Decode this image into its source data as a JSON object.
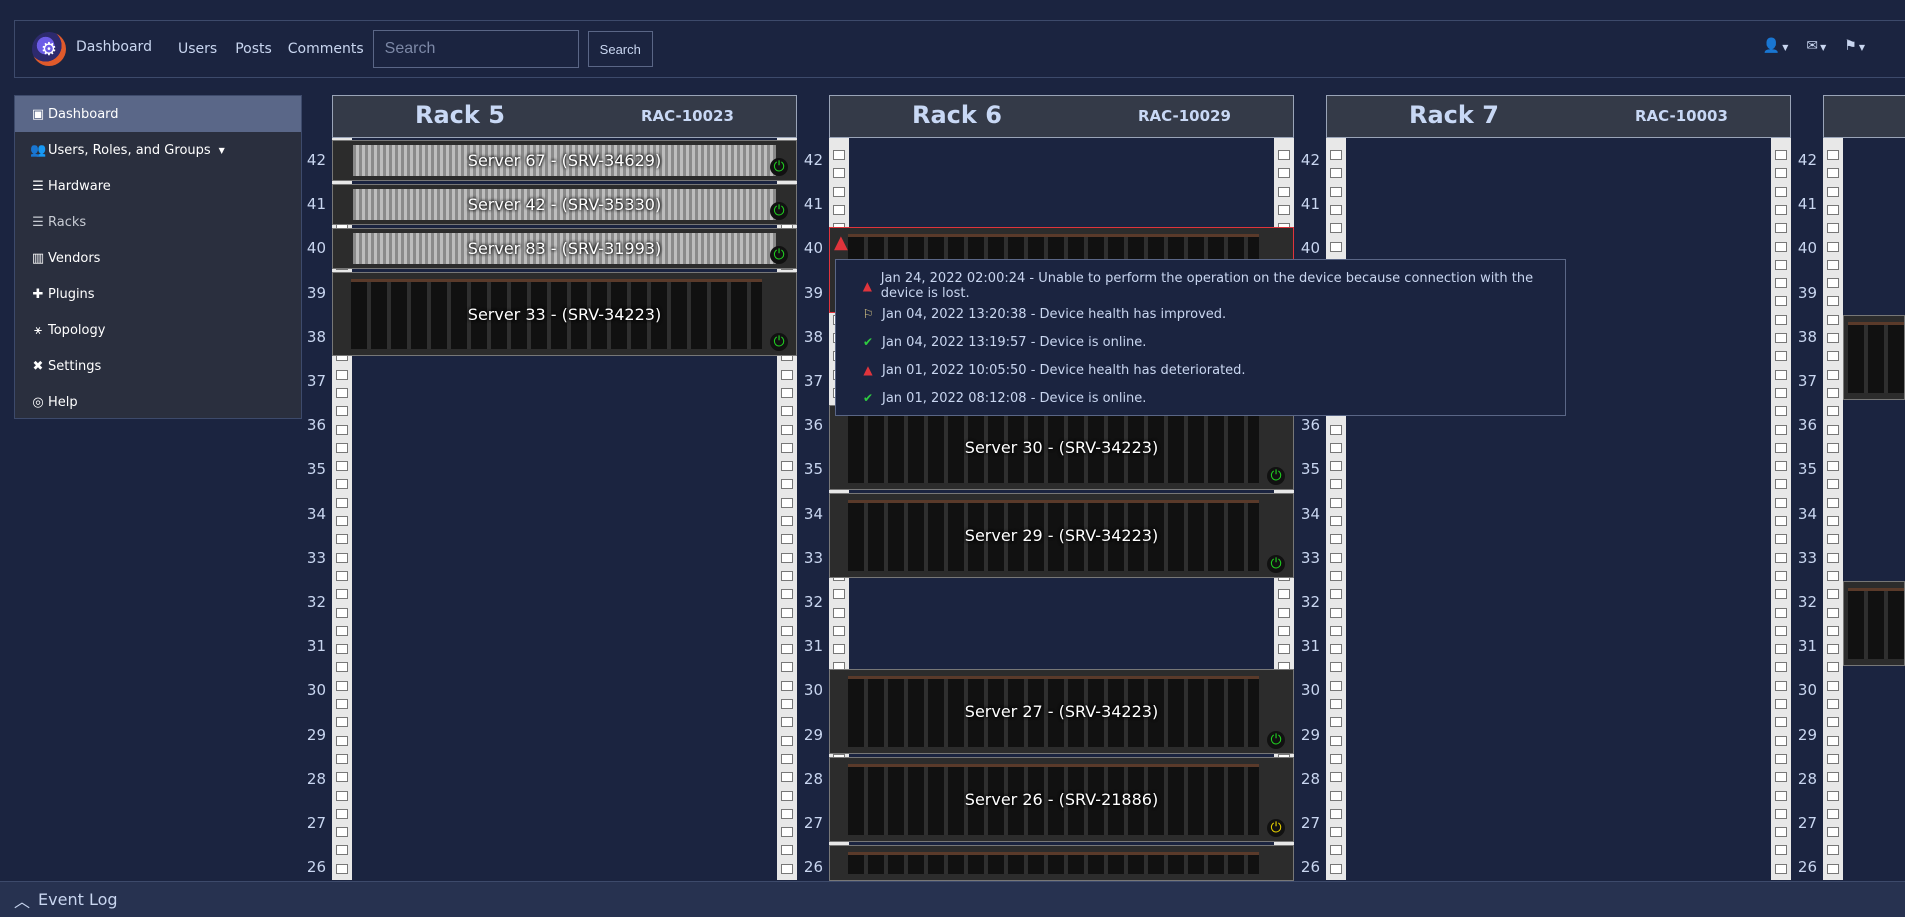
{
  "navbar": {
    "brand": "Dashboard",
    "links": [
      "Users",
      "Posts",
      "Comments"
    ],
    "search_placeholder": "Search",
    "search_button": "Search"
  },
  "sidebar": {
    "items": [
      {
        "label": "Dashboard",
        "icon": "dashboard-icon"
      },
      {
        "label": "Users, Roles, and Groups",
        "icon": "users-icon"
      },
      {
        "label": "Hardware",
        "icon": "hardware-icon"
      },
      {
        "label": "Racks",
        "icon": "racks-icon"
      },
      {
        "label": "Vendors",
        "icon": "vendors-icon"
      },
      {
        "label": "Plugins",
        "icon": "plugins-icon"
      },
      {
        "label": "Topology",
        "icon": "topology-icon"
      },
      {
        "label": "Settings",
        "icon": "settings-icon"
      },
      {
        "label": "Help",
        "icon": "help-icon"
      }
    ]
  },
  "unit_numbers": [
    "42",
    "41",
    "40",
    "39",
    "38",
    "37",
    "36",
    "35",
    "34",
    "33",
    "32",
    "31",
    "30",
    "29",
    "28",
    "27",
    "26"
  ],
  "racks": [
    {
      "name": "Rack 5",
      "code": "RAC-10023"
    },
    {
      "name": "Rack 6",
      "code": "RAC-10029"
    },
    {
      "name": "Rack 7",
      "code": "RAC-10003"
    }
  ],
  "servers": {
    "rack5": [
      "Server 67 - (SRV-34629)",
      "Server 42 - (SRV-35330)",
      "Server 83 - (SRV-31993)",
      "Server 33 - (SRV-34223)"
    ],
    "rack6": [
      "Server 30 - (SRV-34223)",
      "Server 29 - (SRV-34223)",
      "Server 27 - (SRV-34223)",
      "Server 26 - (SRV-21886)"
    ]
  },
  "tooltip": {
    "events": [
      {
        "text": "Jan 24, 2022 02:00:24 - Unable to perform the operation on the device because connection with the device is lost.",
        "type": "error"
      },
      {
        "text": "Jan 04, 2022 13:20:38 - Device health has improved.",
        "type": "flag"
      },
      {
        "text": "Jan 04, 2022 13:19:57 - Device is online.",
        "type": "ok"
      },
      {
        "text": "Jan 01, 2022 10:05:50 - Device health has deteriorated.",
        "type": "error"
      },
      {
        "text": "Jan 01, 2022 08:12:08 - Device is online.",
        "type": "ok"
      }
    ]
  },
  "event_log": {
    "label": "Event Log"
  },
  "colors": {
    "background": "#1b2440",
    "ok": "#2ecc40",
    "error": "#e0343c",
    "warn": "#e6d000"
  }
}
